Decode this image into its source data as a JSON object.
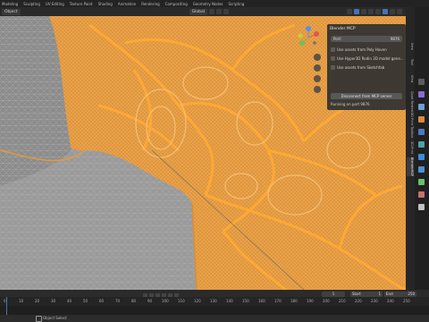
{
  "tabs": [
    "Modeling",
    "Sculpting",
    "UV Editing",
    "Texture Paint",
    "Shading",
    "Animation",
    "Rendering",
    "Compositing",
    "Geometry Nodes",
    "Scripting"
  ],
  "viewport_header": {
    "mode": "Object",
    "orientation": "Global",
    "options_label": "Options"
  },
  "npanel_tabs": [
    "Item",
    "Tool",
    "View",
    "Quad Remesh",
    "3D Print Toolbox",
    "3D-Print",
    "BlenderMCP"
  ],
  "mcp_panel": {
    "title": "Blender MCP",
    "port_label": "Port:",
    "port_value": "9876",
    "options": [
      "Use assets from Poly Haven",
      "Use Hyper3D Rodin 3D model gene...",
      "Use assets from Sketchfab"
    ],
    "disconnect_label": "Disconnect from MCP server",
    "status": "Running on port 9876"
  },
  "timeline": {
    "ticks": [
      "0",
      "10",
      "20",
      "30",
      "40",
      "50",
      "60",
      "70",
      "80",
      "90",
      "100",
      "110",
      "120",
      "130",
      "140",
      "150",
      "160",
      "170",
      "180",
      "190",
      "200",
      "210",
      "220",
      "230",
      "240",
      "250"
    ],
    "current_frame": "1",
    "start_label": "Start",
    "start_value": "1",
    "end_label": "End",
    "end_value": "250"
  },
  "statusbar": {
    "text": "Object Select"
  },
  "colors": {
    "accent": "#4772b3",
    "selection": "#f29a21",
    "mesh": "#9a9a9a"
  }
}
